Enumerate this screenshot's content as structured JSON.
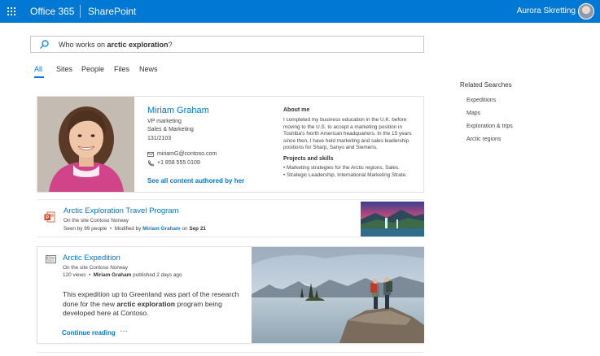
{
  "topbar": {
    "suite_name": "Office 365",
    "site_name": "SharePoint",
    "user_name": "Aurora Skretting",
    "color": "#0078d4"
  },
  "search": {
    "query_prefix": "Who works on ",
    "query_bold": "arctic exploration",
    "query_suffix": "?"
  },
  "tabs": [
    {
      "label": "All",
      "active": true
    },
    {
      "label": "Sites",
      "active": false
    },
    {
      "label": "People",
      "active": false
    },
    {
      "label": "Files",
      "active": false
    },
    {
      "label": "News",
      "active": false
    }
  ],
  "related": {
    "title": "Related Searches",
    "items": [
      "Expeditions",
      "Maps",
      "Exploration & trips",
      "Arctic regions"
    ]
  },
  "person": {
    "name": "Miriam Graham",
    "title": "VP marketing",
    "department": "Sales & Marketing",
    "office": "131/2103",
    "email": "miriamG@contoso.com",
    "phone": "+1 858 555 0109",
    "see_all": "See all content authored by her",
    "about_title": "About me",
    "about_text": "I completed my business education in the U.K. before moving to the U.S. to accept a marketing position in Toshiba's North American headquarters. In the 15 years since then, I have held marketing and sales leadership positions for Sharp, Sanyo and Siemens.",
    "projects_title": "Projects and skills",
    "projects": [
      "• Marketing strategies for the Arctic regions, Sales.",
      "• Strategic Leadership, International Marketing Strate."
    ]
  },
  "travel": {
    "title": "Arctic Exploration Travel Program",
    "site": "On the site Contoso Norway",
    "seen_by": "Seen by 99 people",
    "modified_by_label": "Modified by",
    "modified_by_name": "Miriam Graham",
    "modified_on_label": "on",
    "modified_date": "Sep 21",
    "dot": "•"
  },
  "expedition": {
    "title": "Arctic Expedition",
    "site": "On the site Contoso Norway",
    "views": "120 views",
    "dot": "•",
    "author": "Miriam Graham",
    "published": "published 2 days ago",
    "body_prefix": "This expedition up to Greenland was part of the research done for the new ",
    "body_bold": "arctic exploration",
    "body_suffix": " program being developed here at Contoso.",
    "continue": "Continue reading",
    "more": "···"
  }
}
